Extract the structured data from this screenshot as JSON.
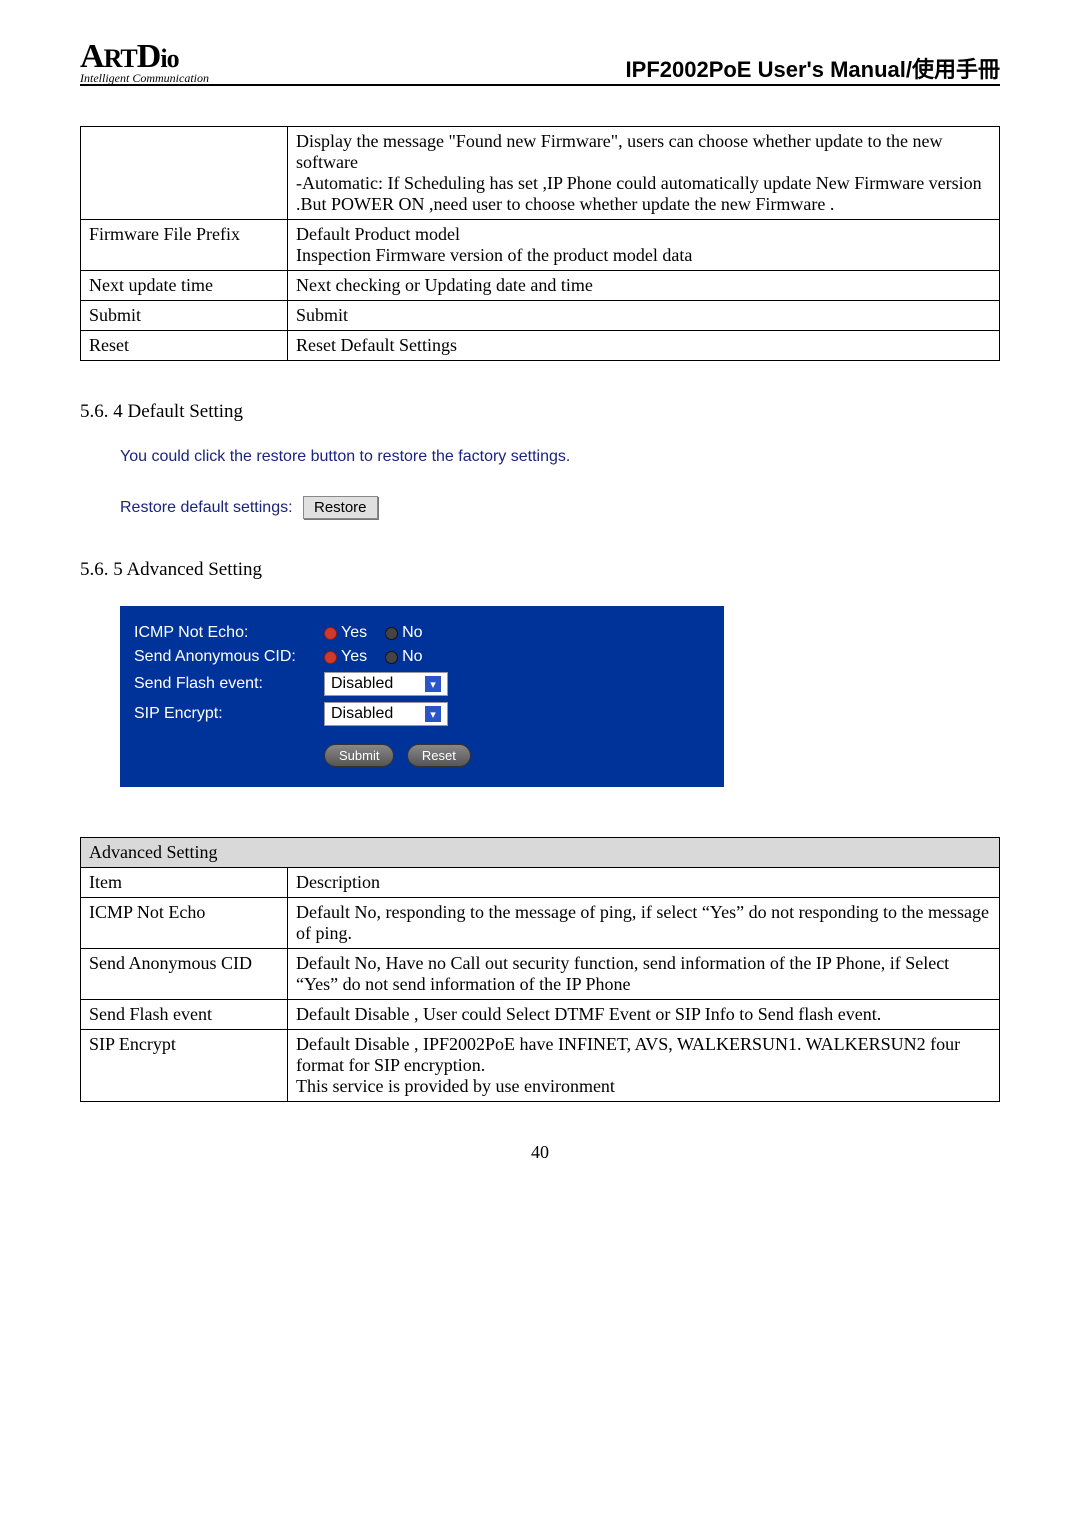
{
  "header": {
    "logo_main": "ARTDio",
    "logo_sub": "Intelligent Communication",
    "doc_title": "IPF2002PoE User's Manual/使用手冊"
  },
  "table1": {
    "rows": [
      {
        "col1": "",
        "col2": "Display the message \"Found new Firmware\", users can choose whether update to the new software\n-Automatic: If Scheduling has set ,IP Phone could automatically update New Firmware version .But POWER ON ,need user to choose whether update the new Firmware ."
      },
      {
        "col1": "Firmware File Prefix",
        "col2": "Default Product model\nInspection Firmware version of the product model data"
      },
      {
        "col1": "Next update time",
        "col2": "Next checking or Updating date and time"
      },
      {
        "col1": "Submit",
        "col2": "Submit"
      },
      {
        "col1": "Reset",
        "col2": "Reset Default Settings"
      }
    ]
  },
  "section_default": {
    "heading": "5.6. 4 Default Setting",
    "line1": "You could click the restore button to restore the factory settings.",
    "line2_label": "Restore default settings:",
    "restore_btn": "Restore"
  },
  "section_advanced": {
    "heading": "5.6. 5 Advanced Setting",
    "panel": {
      "icmp_label": "ICMP Not Echo:",
      "cid_label": "Send Anonymous CID:",
      "flash_label": "Send Flash event:",
      "sip_label": "SIP Encrypt:",
      "yes": "Yes",
      "no": "No",
      "disabled": "Disabled",
      "submit": "Submit",
      "reset": "Reset"
    }
  },
  "table2": {
    "title": "Advanced Setting",
    "item_hdr": "Item",
    "desc_hdr": "Description",
    "rows": [
      {
        "item": "ICMP Not Echo",
        "desc": "Default No, responding to the message of ping, if select “Yes” do not responding to the message of ping."
      },
      {
        "item": "Send Anonymous CID",
        "desc": "Default No, Have no Call out security function, send information of the IP Phone, if Select “Yes” do not send information of the IP Phone"
      },
      {
        "item": "Send Flash event",
        "desc": "Default Disable , User could Select DTMF Event or SIP Info to Send flash event."
      },
      {
        "item": "SIP Encrypt",
        "desc": "Default Disable , IPF2002PoE have INFINET, AVS, WALKERSUN1. WALKERSUN2 four format for SIP encryption.\nThis service is provided by use environment"
      }
    ]
  },
  "page_number": "40"
}
